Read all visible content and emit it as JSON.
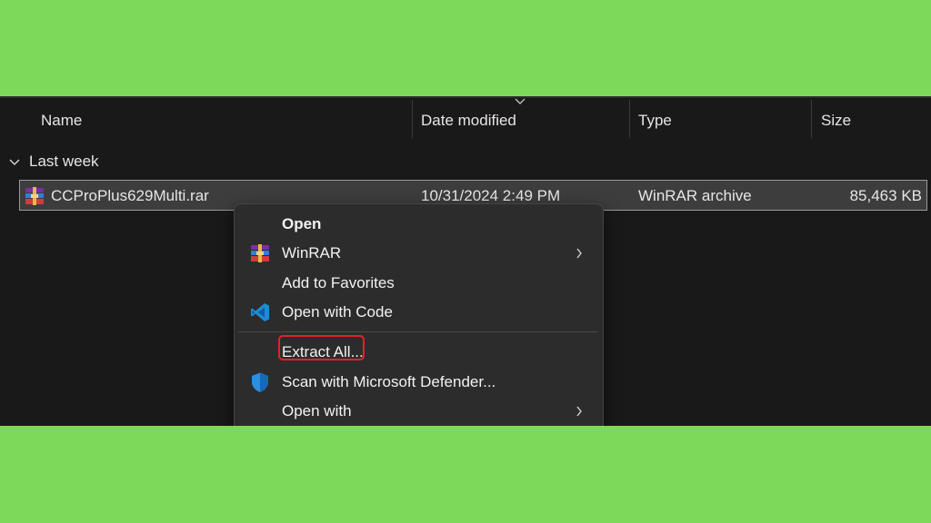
{
  "columns": {
    "name": "Name",
    "date_modified": "Date modified",
    "type": "Type",
    "size": "Size"
  },
  "group": {
    "label": "Last week"
  },
  "file": {
    "name": "CCProPlus629Multi.rar",
    "date_modified": "10/31/2024 2:49 PM",
    "type": "WinRAR archive",
    "size": "85,463 KB",
    "icon": "winrar-archive-icon"
  },
  "context_menu": {
    "items": [
      {
        "label": "Open",
        "icon": null,
        "submenu": false,
        "bold": true
      },
      {
        "label": "WinRAR",
        "icon": "winrar-icon",
        "submenu": true
      },
      {
        "label": "Add to Favorites",
        "icon": null,
        "submenu": false
      },
      {
        "label": "Open with Code",
        "icon": "vscode-icon",
        "submenu": false
      },
      {
        "label": "Extract All...",
        "icon": null,
        "submenu": false,
        "highlighted": true
      },
      {
        "label": "Scan with Microsoft Defender...",
        "icon": "defender-shield-icon",
        "submenu": false
      },
      {
        "label": "Open with",
        "icon": null,
        "submenu": true
      }
    ]
  },
  "colors": {
    "background_green": "#7dd95a",
    "explorer_bg": "#191919",
    "menu_bg": "#2c2c2c",
    "highlight_border": "#e02424"
  }
}
